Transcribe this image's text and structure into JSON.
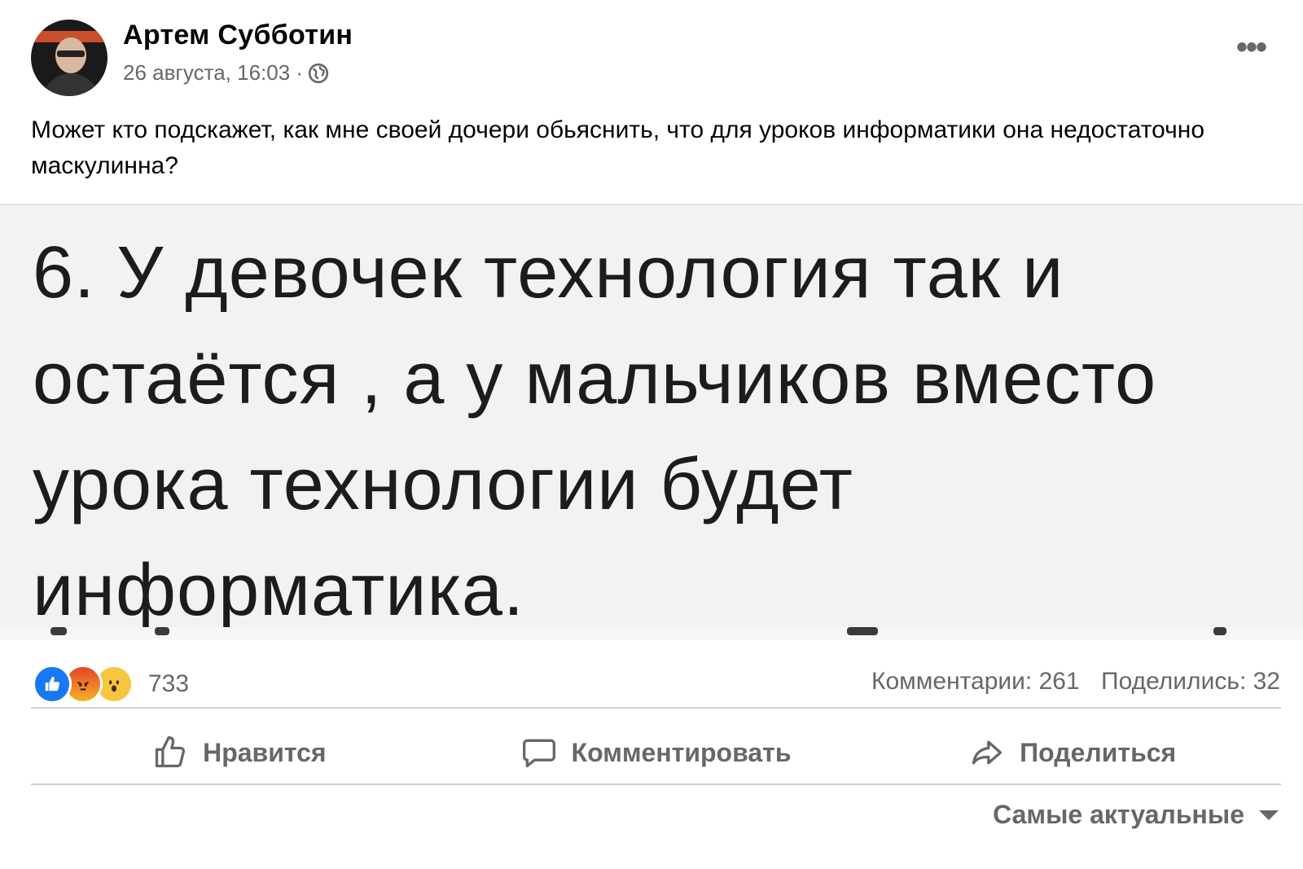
{
  "post": {
    "author": "Артем Субботин",
    "timestamp": "26 августа, 16:03 ·",
    "more_label": "•••",
    "text": "Может кто подскажет, как мне своей дочери обьяснить, что для уроков информатики она недостаточно маскулинна?",
    "image_text": "6. У девочек технология так и остаётся , а у мальчиков вместо урока технологии будет информатика.",
    "privacy_icon": "globe-icon"
  },
  "stats": {
    "reaction_icons": [
      "like-icon",
      "angry-icon",
      "wow-icon"
    ],
    "reaction_count": "733",
    "comments": "Комментарии: 261",
    "shares": "Поделились: 32"
  },
  "actions": {
    "like": "Нравится",
    "comment": "Комментировать",
    "share": "Поделиться"
  },
  "comments_sort": {
    "selected": "Самые актуальные"
  },
  "colors": {
    "secondary_text": "#65676b",
    "like_blue": "#1877f2",
    "divider": "#ced0d4"
  }
}
